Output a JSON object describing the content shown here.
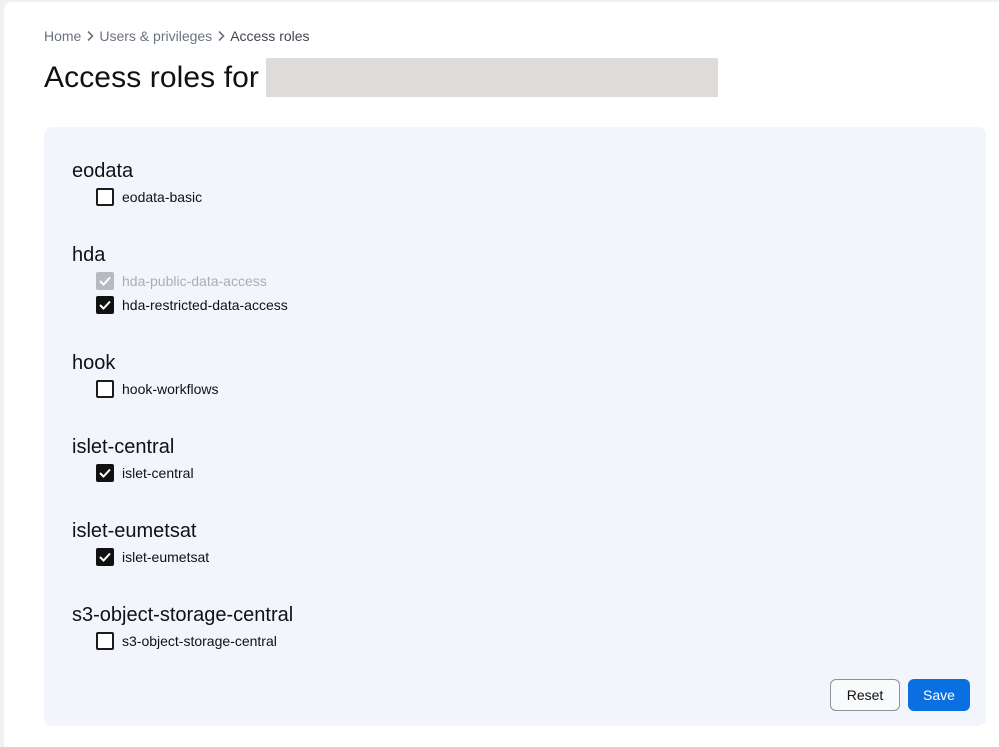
{
  "breadcrumb": {
    "items": [
      "Home",
      "Users & privileges",
      "Access roles"
    ]
  },
  "title": "Access roles for",
  "groups": [
    {
      "name": "eodata",
      "roles": [
        {
          "label": "eodata-basic",
          "checked": false,
          "disabled": false
        }
      ]
    },
    {
      "name": "hda",
      "roles": [
        {
          "label": "hda-public-data-access",
          "checked": true,
          "disabled": true
        },
        {
          "label": "hda-restricted-data-access",
          "checked": true,
          "disabled": false
        }
      ]
    },
    {
      "name": "hook",
      "roles": [
        {
          "label": "hook-workflows",
          "checked": false,
          "disabled": false
        }
      ]
    },
    {
      "name": "islet-central",
      "roles": [
        {
          "label": "islet-central",
          "checked": true,
          "disabled": false
        }
      ]
    },
    {
      "name": "islet-eumetsat",
      "roles": [
        {
          "label": "islet-eumetsat",
          "checked": true,
          "disabled": false
        }
      ]
    },
    {
      "name": "s3-object-storage-central",
      "roles": [
        {
          "label": "s3-object-storage-central",
          "checked": false,
          "disabled": false
        }
      ]
    }
  ],
  "actions": {
    "reset_label": "Reset",
    "save_label": "Save"
  },
  "colors": {
    "accent": "#0a6fe0",
    "panel_bg": "#f2f5fc",
    "redacted": "#e0dcdc"
  }
}
